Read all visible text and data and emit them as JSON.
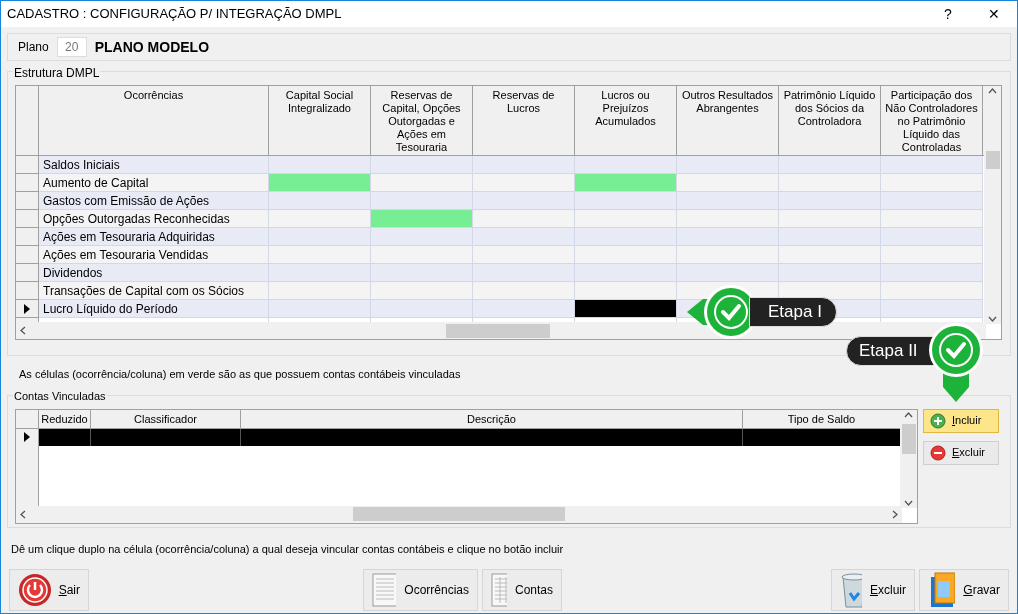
{
  "window": {
    "title": "CADASTRO : CONFIGURAÇÃO P/ INTEGRAÇÃO DMPL",
    "controls": [
      "?",
      "✕"
    ]
  },
  "plano": {
    "label": "Plano",
    "code": "20",
    "name": "PLANO MODELO"
  },
  "estrutura": {
    "title": "Estrutura DMPL",
    "columns": [
      "Ocorrências",
      "Capital Social Integralizado",
      "Reservas de Capital, Opções Outorgadas e Ações em Tesouraria",
      "Reservas de Lucros",
      "Lucros ou Prejuízos Acumulados",
      "Outros Resultados Abrangentes",
      "Patrimônio Líquido dos Sócios da Controladora",
      "Participação dos Não Controladores no Patrimônio Líquido das Controladas"
    ],
    "rows": [
      {
        "label": "Saldos Iniciais",
        "selected": false,
        "linked": [
          false,
          false,
          false,
          false,
          false,
          false,
          false
        ],
        "current": [
          false,
          false,
          false,
          false,
          false,
          false,
          false
        ]
      },
      {
        "label": "Aumento de Capital",
        "selected": false,
        "linked": [
          true,
          false,
          false,
          true,
          false,
          false,
          false
        ],
        "current": [
          false,
          false,
          false,
          false,
          false,
          false,
          false
        ]
      },
      {
        "label": "Gastos com Emissão de Ações",
        "selected": false,
        "linked": [
          false,
          false,
          false,
          false,
          false,
          false,
          false
        ],
        "current": [
          false,
          false,
          false,
          false,
          false,
          false,
          false
        ]
      },
      {
        "label": "Opções Outorgadas Reconhecidas",
        "selected": false,
        "linked": [
          false,
          true,
          false,
          false,
          false,
          false,
          false
        ],
        "current": [
          false,
          false,
          false,
          false,
          false,
          false,
          false
        ]
      },
      {
        "label": "Ações em Tesouraria Adquiridas",
        "selected": false,
        "linked": [
          false,
          false,
          false,
          false,
          false,
          false,
          false
        ],
        "current": [
          false,
          false,
          false,
          false,
          false,
          false,
          false
        ]
      },
      {
        "label": "Ações em Tesouraria Vendidas",
        "selected": false,
        "linked": [
          false,
          false,
          false,
          false,
          false,
          false,
          false
        ],
        "current": [
          false,
          false,
          false,
          false,
          false,
          false,
          false
        ]
      },
      {
        "label": "Dividendos",
        "selected": false,
        "linked": [
          false,
          false,
          false,
          false,
          false,
          false,
          false
        ],
        "current": [
          false,
          false,
          false,
          false,
          false,
          false,
          false
        ]
      },
      {
        "label": "Transações de Capital com os Sócios",
        "selected": false,
        "linked": [
          false,
          false,
          false,
          false,
          false,
          false,
          false
        ],
        "current": [
          false,
          false,
          false,
          false,
          false,
          false,
          false
        ]
      },
      {
        "label": "Lucro Líquido do Período",
        "selected": true,
        "linked": [
          false,
          false,
          false,
          false,
          false,
          false,
          false
        ],
        "current": [
          false,
          false,
          false,
          true,
          false,
          false,
          false
        ]
      }
    ]
  },
  "callouts": [
    {
      "label": "Etapa I",
      "kind": "left"
    },
    {
      "label": "Etapa II",
      "kind": "down"
    }
  ],
  "legend": "As células (ocorrência/coluna) em verde são as que possuem contas contábeis vinculadas",
  "contas": {
    "title": "Contas Vinculadas",
    "columns": [
      "Reduzido",
      "Classificador",
      "Descrição",
      "Tipo de Saldo"
    ],
    "rows": [
      {
        "selected": true
      }
    ],
    "buttons": [
      {
        "label": "Incluir",
        "kind": "add",
        "highlighted": true
      },
      {
        "label": "Excluir",
        "kind": "remove",
        "highlighted": false
      }
    ]
  },
  "hint": "Dê um clique duplo na célula (ocorrência/coluna) a qual deseja vincular contas contábeis e clique no botão incluir",
  "footer": {
    "left": [
      {
        "label": "Sair",
        "kind": "power"
      }
    ],
    "center": [
      {
        "label": "Ocorrências",
        "kind": "list"
      },
      {
        "label": "Contas",
        "kind": "grid"
      }
    ],
    "right": [
      {
        "label": "Excluir",
        "kind": "trash"
      },
      {
        "label": "Gravar",
        "kind": "folder"
      }
    ]
  }
}
